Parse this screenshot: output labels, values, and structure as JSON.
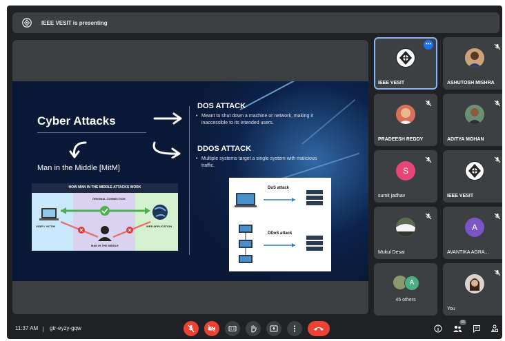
{
  "presenting": {
    "text": "IEEE VESIT is presenting"
  },
  "slide": {
    "title": "Cyber Attacks",
    "mitm_label": "Man in the Middle [MitM]",
    "dos_heading": "DOS ATTACK",
    "dos_bullet": "Meant to shut down a machine or network, making it inaccessible to its intended users.",
    "ddos_heading": "DDOS ATTACK",
    "ddos_bullet": "Multiple systems target a single system with malicious traffic.",
    "mitm_graphic": {
      "title": "HOW MAN IN THE MIDDLE ATTACKS WORK",
      "original_connection": "ORIGINAL CONNECTION",
      "user_victim": "USER / VICTIM",
      "man_in_middle": "MAN IN THE MIDDLE",
      "web_application": "WEB APPLICATION"
    },
    "attack_graphic": {
      "dos_label": "DoS attack",
      "ddos_label": "DDoS attack"
    }
  },
  "participants": [
    {
      "name": "IEEE VESIT",
      "avatar": "ieee-logo",
      "active": true
    },
    {
      "name": "ASHUTOSH MISHRA",
      "avatar": "photo"
    },
    {
      "name": "PRADEESH REDDY",
      "avatar": "photo"
    },
    {
      "name": "ADITYA MOHAN",
      "avatar": "photo"
    },
    {
      "name": "sumit jadhav",
      "avatar": "letter",
      "letter": "S",
      "color": "#e8457a"
    },
    {
      "name": "IEEE VESIT",
      "avatar": "ieee-logo"
    },
    {
      "name": "Mukul Desai",
      "avatar": "photo"
    },
    {
      "name": "AVANTIKA AGRA...",
      "avatar": "letter",
      "letter": "A",
      "color": "#7b55c4"
    },
    {
      "name": "45 others",
      "avatar": "group",
      "letter": "A",
      "color": "#4caf82"
    },
    {
      "name": "You",
      "avatar": "photo"
    }
  ],
  "bottom": {
    "time": "11:37 AM",
    "meeting_code": "gtr-eyzy-gqw",
    "people_count": "55"
  },
  "colors": {
    "danger": "#ea4335",
    "accent": "#8ab4f8",
    "tile": "#3c4043",
    "background": "#202124"
  }
}
